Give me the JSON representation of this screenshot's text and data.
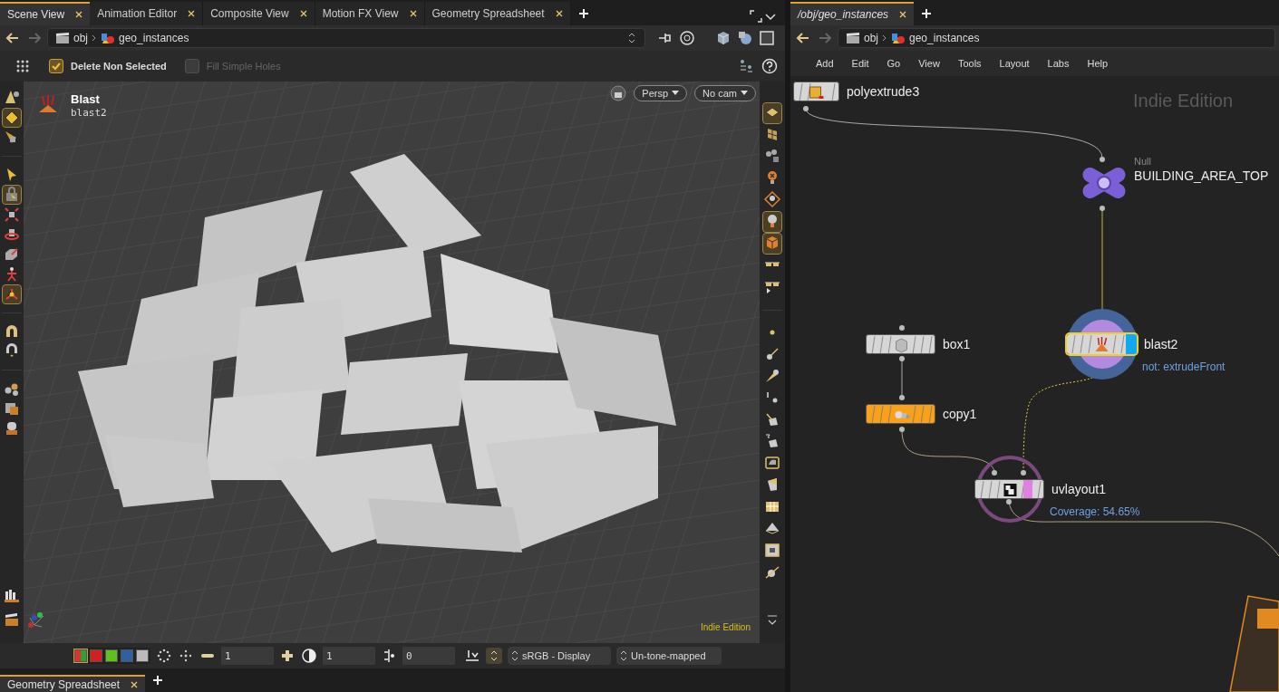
{
  "scene_pane": {
    "tabs": [
      {
        "label": "Scene View",
        "selected": true
      },
      {
        "label": "Animation Editor",
        "selected": false
      },
      {
        "label": "Composite View",
        "selected": false
      },
      {
        "label": "Motion FX View",
        "selected": false
      },
      {
        "label": "Geometry Spreadsheet",
        "selected": false
      }
    ],
    "path": [
      "obj",
      "geo_instances"
    ],
    "options": [
      {
        "label": "Delete Non Selected",
        "checked": true,
        "disabled": false
      },
      {
        "label": "Fill Simple Holes",
        "checked": false,
        "disabled": true
      }
    ],
    "viewport": {
      "node_type": "Blast",
      "node_name": "blast2",
      "view": "Persp",
      "camera": "No cam",
      "edition": "Indie Edition"
    },
    "display_bar": {
      "fields": [
        "1",
        "1",
        "0"
      ],
      "colorspace": "sRGB - Display",
      "tonemap": "Un-tone-mapped"
    }
  },
  "bottom_tabs": [
    {
      "label": "Geometry Spreadsheet",
      "selected": true
    }
  ],
  "network_pane": {
    "tabs": [
      {
        "label": "/obj/geo_instances",
        "selected": true
      }
    ],
    "path": [
      "obj",
      "geo_instances"
    ],
    "menu": [
      "Add",
      "Edit",
      "Go",
      "View",
      "Tools",
      "Layout",
      "Labs",
      "Help"
    ],
    "watermark": "Indie Edition",
    "nodes": [
      {
        "kind": "sop",
        "name": "polyextrude3",
        "color": "#d6d6d6",
        "selected": false
      },
      {
        "kind": "null",
        "type": "Null",
        "name": "BUILDING_AREA_TOP",
        "color": "#7b5fd6",
        "selected": false
      },
      {
        "kind": "sop",
        "name": "box1",
        "color": "#d6d6d6",
        "selected": false
      },
      {
        "kind": "sop",
        "name": "copy1",
        "color": "#f9a11b",
        "selected": false
      },
      {
        "kind": "sop",
        "name": "blast2",
        "color": "#d6d6d6",
        "selected": true,
        "display_flag": true,
        "template_flag": false,
        "comment": "not: extrudeFront"
      },
      {
        "kind": "sop",
        "name": "uvlayout1",
        "color": "#d6d6d6",
        "selected": false,
        "display_flag": false,
        "template_flag": true,
        "comment": "Coverage: 54.65%"
      }
    ]
  }
}
